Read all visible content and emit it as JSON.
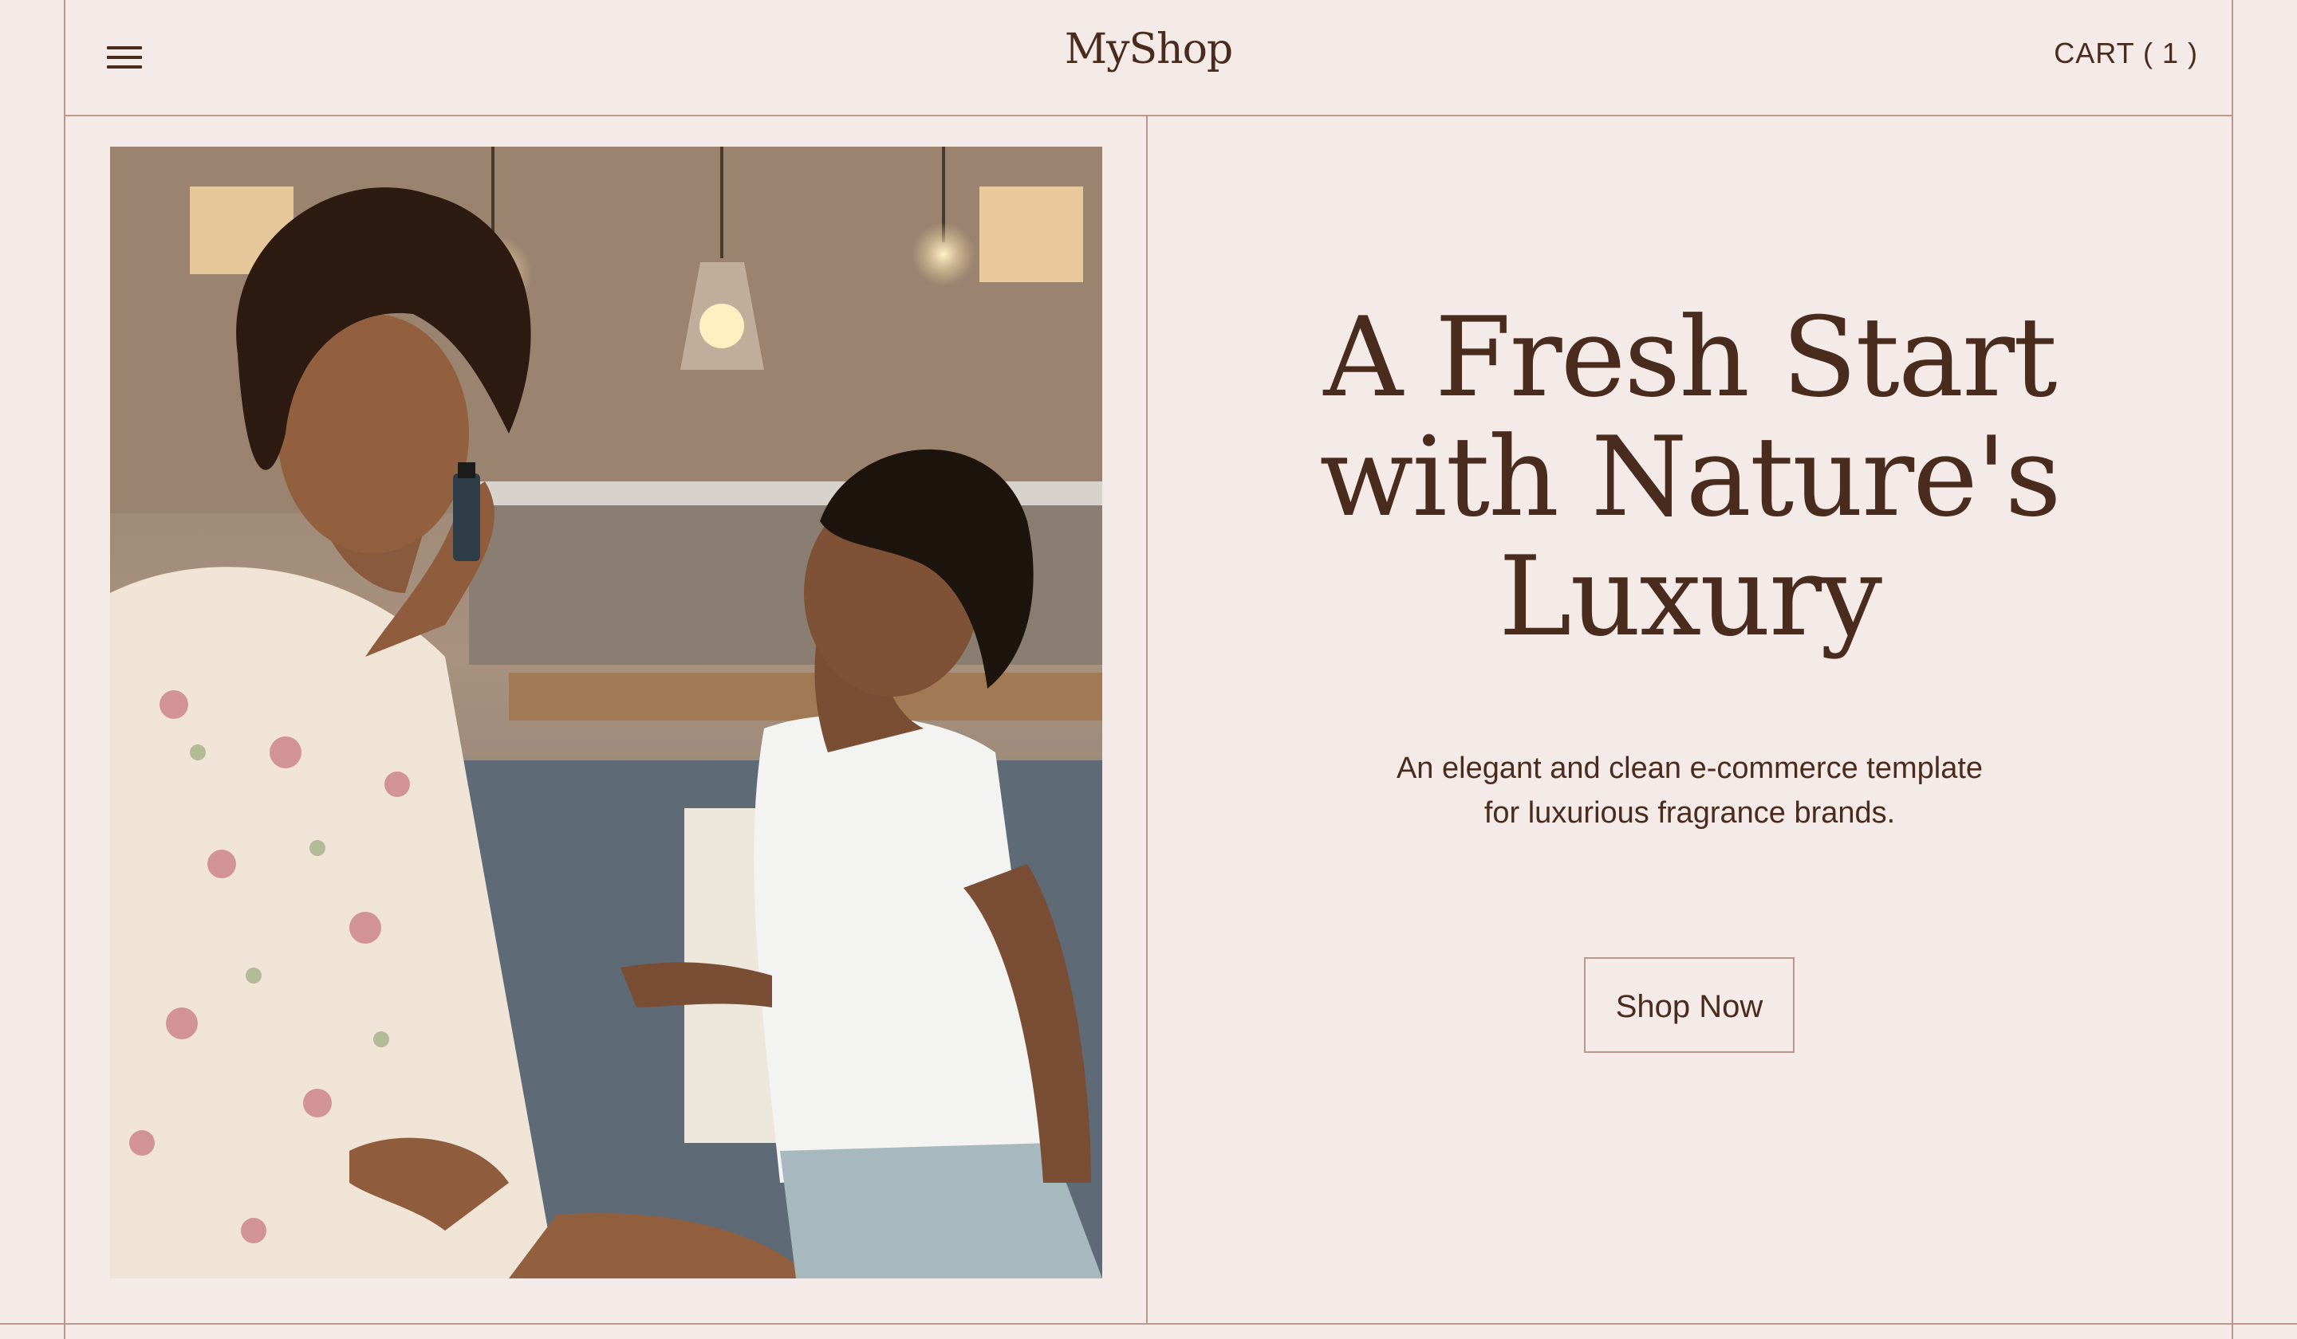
{
  "header": {
    "logo": "MyShop",
    "cart_label": "CART ( 1 )",
    "menu_icon": "hamburger-menu-icon"
  },
  "hero": {
    "title_lines": [
      "A Fresh Start",
      "with Nature's",
      "Luxury"
    ],
    "subtitle_lines": [
      "An elegant and clean e-commerce template",
      "for luxurious fragrance brands."
    ],
    "cta_label": "Shop Now",
    "image_subject": "mother-smelling-essential-oil-with-son"
  },
  "colors": {
    "background": "#f4eae8",
    "text": "#4a2c1f",
    "border": "#b9978a"
  }
}
